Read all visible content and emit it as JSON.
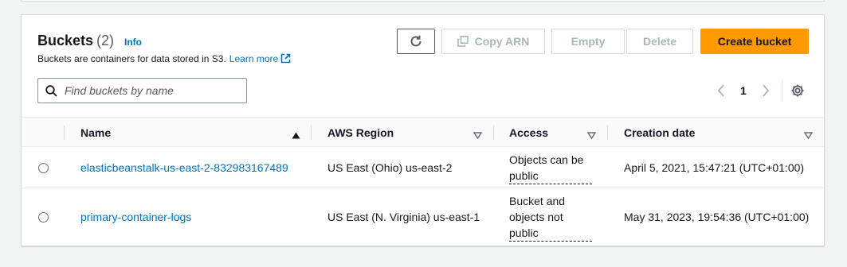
{
  "header": {
    "title": "Buckets",
    "count": "(2)",
    "info_label": "Info",
    "description": "Buckets are containers for data stored in S3.",
    "learn_more": "Learn more"
  },
  "toolbar": {
    "refresh_icon": "refresh-icon",
    "copy_arn_label": "Copy ARN",
    "empty_label": "Empty",
    "delete_label": "Delete",
    "create_label": "Create bucket"
  },
  "search": {
    "placeholder": "Find buckets by name",
    "value": ""
  },
  "pagination": {
    "current_page": "1"
  },
  "table": {
    "columns": [
      "Name",
      "AWS Region",
      "Access",
      "Creation date"
    ],
    "rows": [
      {
        "name": "elasticbeanstalk-us-east-2-832983167489",
        "region": "US East (Ohio) us-east-2",
        "access_line1": "Objects can be",
        "access_line2": "public",
        "access_line3": "",
        "created": "April 5, 2021, 15:47:21 (UTC+01:00)"
      },
      {
        "name": "primary-container-logs",
        "region": "US East (N. Virginia) us-east-1",
        "access_line1": "Bucket and",
        "access_line2": "objects not",
        "access_line3": "public",
        "created": "May 31, 2023, 19:54:36 (UTC+01:00)"
      }
    ]
  },
  "colors": {
    "accent": "#ff9900",
    "link": "#0073bb",
    "text": "#16191f",
    "disabled": "#aab7b8"
  }
}
